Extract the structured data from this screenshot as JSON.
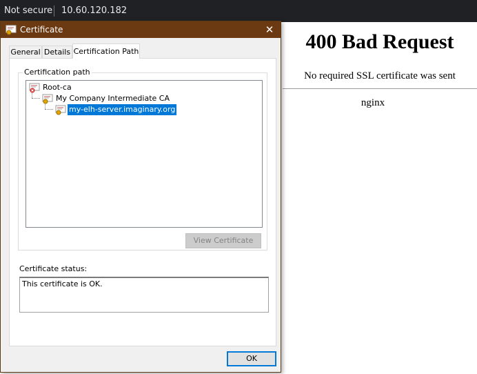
{
  "browser": {
    "security_label": "Not secure",
    "url": "10.60.120.182"
  },
  "page": {
    "heading": "400 Bad Request",
    "message": "No required SSL certificate was sent",
    "server": "nginx"
  },
  "dialog": {
    "title": "Certificate",
    "close_glyph": "✕",
    "tabs": [
      {
        "label": "General",
        "active": false
      },
      {
        "label": "Details",
        "active": false
      },
      {
        "label": "Certification Path",
        "active": true
      }
    ],
    "cert_path_label": "Certification path",
    "tree": [
      {
        "label": "Root-ca",
        "icon": "certificate-error-icon",
        "selected": false
      },
      {
        "label": "My Company Intermediate CA",
        "icon": "certificate-icon",
        "selected": false
      },
      {
        "label": "my-elh-server.imaginary.org",
        "icon": "certificate-icon",
        "selected": true
      }
    ],
    "view_certificate_label": "View Certificate",
    "status_label": "Certificate status:",
    "status_text": "This certificate is OK.",
    "ok_label": "OK"
  },
  "colors": {
    "titlebar": "#6b3a12",
    "selection": "#0078d7",
    "browser_bar": "#202124"
  }
}
